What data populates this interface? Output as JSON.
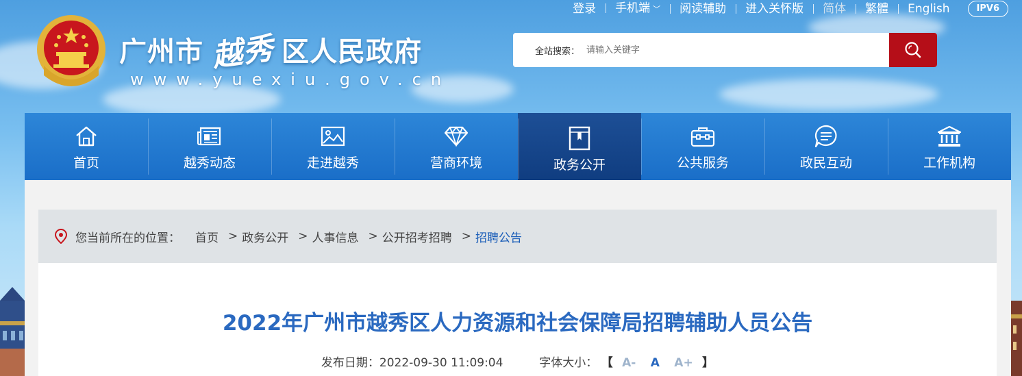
{
  "top_links": {
    "login": "登录",
    "mobile": "手机端",
    "reading_aid": "阅读辅助",
    "care_mode": "进入关怀版",
    "simplified": "简体",
    "traditional": "繁體",
    "english": "English",
    "ipv6": "IPV6"
  },
  "header": {
    "title_left": "广州市",
    "title_callig": "越秀",
    "title_right": "区人民政府",
    "domain": "www.yuexiu.gov.cn"
  },
  "search": {
    "label": "全站搜索：",
    "placeholder": "请输入关键字"
  },
  "nav": {
    "items": [
      {
        "label": "首页",
        "icon": "home-icon"
      },
      {
        "label": "越秀动态",
        "icon": "newspaper-icon"
      },
      {
        "label": "走进越秀",
        "icon": "picture-icon"
      },
      {
        "label": "营商环境",
        "icon": "diamond-icon"
      },
      {
        "label": "政务公开",
        "icon": "document-icon",
        "active": true
      },
      {
        "label": "公共服务",
        "icon": "briefcase-icon"
      },
      {
        "label": "政民互动",
        "icon": "chat-icon"
      },
      {
        "label": "工作机构",
        "icon": "institution-icon"
      }
    ]
  },
  "breadcrumb": {
    "lead": "您当前所在的位置：",
    "items": [
      "首页",
      "政务公开",
      "人事信息",
      "公开招考招聘",
      "招聘公告"
    ]
  },
  "article": {
    "title": "2022年广州市越秀区人力资源和社会保障局招聘辅助人员公告",
    "date_label": "发布日期：",
    "date": "2022-09-30 11:09:04",
    "font_label": "字体大小：",
    "font_small": "A-",
    "font_normal": "A",
    "font_large": "A+",
    "bracket_open": "【",
    "bracket_close": "】"
  },
  "colors": {
    "nav_bg": "#1f77cf",
    "nav_active": "#114185",
    "search_btn": "#b50e18",
    "title": "#2a69c0"
  }
}
